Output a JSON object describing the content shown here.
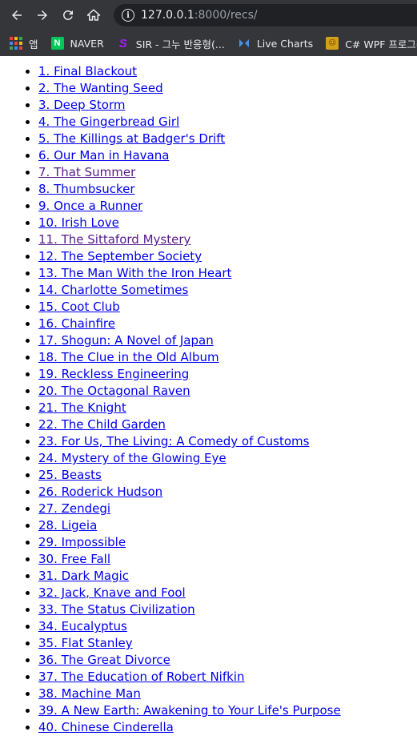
{
  "browser": {
    "url_host": "127.0.0.1",
    "url_rest": ":8000/recs/",
    "bookmarks": [
      {
        "label": "앱",
        "icon": "apps-grid-icon"
      },
      {
        "label": "NAVER",
        "icon": "naver-icon"
      },
      {
        "label": "SIR - 그누 반응형(...",
        "icon": "sir-icon"
      },
      {
        "label": "Live Charts",
        "icon": "live-charts-icon"
      },
      {
        "label": "C# WPF 프로그래...",
        "icon": "wpf-icon"
      }
    ]
  },
  "recs": [
    {
      "text": "1. Final Blackout",
      "visited": false
    },
    {
      "text": "2. The Wanting Seed",
      "visited": false
    },
    {
      "text": "3. Deep Storm",
      "visited": false
    },
    {
      "text": "4. The Gingerbread Girl",
      "visited": false
    },
    {
      "text": "5. The Killings at Badger's Drift",
      "visited": false
    },
    {
      "text": "6. Our Man in Havana",
      "visited": false
    },
    {
      "text": "7. That Summer",
      "visited": true
    },
    {
      "text": "8. Thumbsucker",
      "visited": false
    },
    {
      "text": "9. Once a Runner",
      "visited": false
    },
    {
      "text": "10. Irish Love",
      "visited": false
    },
    {
      "text": "11. The Sittaford Mystery",
      "visited": true
    },
    {
      "text": "12. The September Society",
      "visited": false
    },
    {
      "text": "13. The Man With the Iron Heart",
      "visited": false
    },
    {
      "text": "14. Charlotte Sometimes",
      "visited": false
    },
    {
      "text": "15. Coot Club",
      "visited": false
    },
    {
      "text": "16. Chainfire",
      "visited": false
    },
    {
      "text": "17. Shogun: A Novel of Japan",
      "visited": false
    },
    {
      "text": "18. The Clue in the Old Album",
      "visited": false
    },
    {
      "text": "19. Reckless Engineering",
      "visited": false
    },
    {
      "text": "20. The Octagonal Raven",
      "visited": false
    },
    {
      "text": "21. The Knight",
      "visited": false
    },
    {
      "text": "22. The Child Garden",
      "visited": false
    },
    {
      "text": "23. For Us, The Living: A Comedy of Customs",
      "visited": false
    },
    {
      "text": "24. Mystery of the Glowing Eye",
      "visited": false
    },
    {
      "text": "25. Beasts",
      "visited": false
    },
    {
      "text": "26. Roderick Hudson",
      "visited": false
    },
    {
      "text": "27. Zendegi",
      "visited": false
    },
    {
      "text": "28. Ligeia",
      "visited": false
    },
    {
      "text": "29. Impossible",
      "visited": false
    },
    {
      "text": "30. Free Fall",
      "visited": false
    },
    {
      "text": "31. Dark Magic",
      "visited": false
    },
    {
      "text": "32. Jack, Knave and Fool",
      "visited": false
    },
    {
      "text": "33. The Status Civilization",
      "visited": false
    },
    {
      "text": "34. Eucalyptus",
      "visited": false
    },
    {
      "text": "35. Flat Stanley",
      "visited": false
    },
    {
      "text": "36. The Great Divorce",
      "visited": false
    },
    {
      "text": "37. The Education of Robert Nifkin",
      "visited": false
    },
    {
      "text": "38. Machine Man",
      "visited": false
    },
    {
      "text": "39. A New Earth: Awakening to Your Life's Purpose",
      "visited": false
    },
    {
      "text": "40. Chinese Cinderella",
      "visited": false
    }
  ]
}
